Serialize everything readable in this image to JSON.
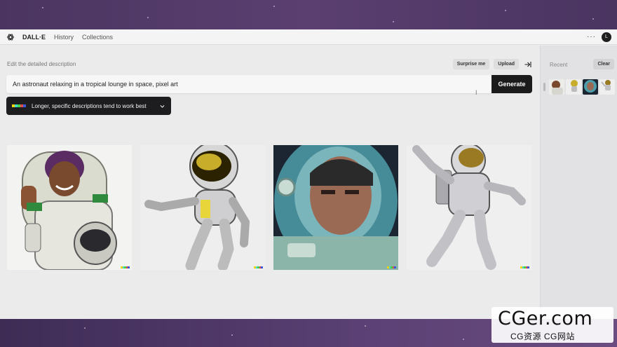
{
  "nav": {
    "brand": "DALL·E",
    "links": [
      "History",
      "Collections"
    ],
    "more": "···",
    "avatar_initial": "L"
  },
  "editor": {
    "label": "Edit the detailed description",
    "surprise_label": "Surprise me",
    "upload_label": "Upload",
    "prompt_value": "An astronaut relaxing in a tropical lounge in space, pixel art",
    "generate_label": "Generate",
    "tip_text": "Longer, specific descriptions tend to work best"
  },
  "gallery": {
    "items": [
      {
        "icon": "astronaut-woman-thumbs-up-image"
      },
      {
        "icon": "cartoon-astronaut-gold-visor-image"
      },
      {
        "icon": "astronaut-man-helmet-closeup-image"
      },
      {
        "icon": "astronaut-pointing-image"
      }
    ]
  },
  "sidebar": {
    "recent_label": "Recent",
    "clear_label": "Clear"
  },
  "watermark": {
    "main": "CGer.com",
    "sub": "CG资源 CG网站"
  },
  "colors": {
    "accent_dark": "#1b1b1b",
    "background_purple": "#4b3560",
    "app_bg": "#ebebec"
  }
}
